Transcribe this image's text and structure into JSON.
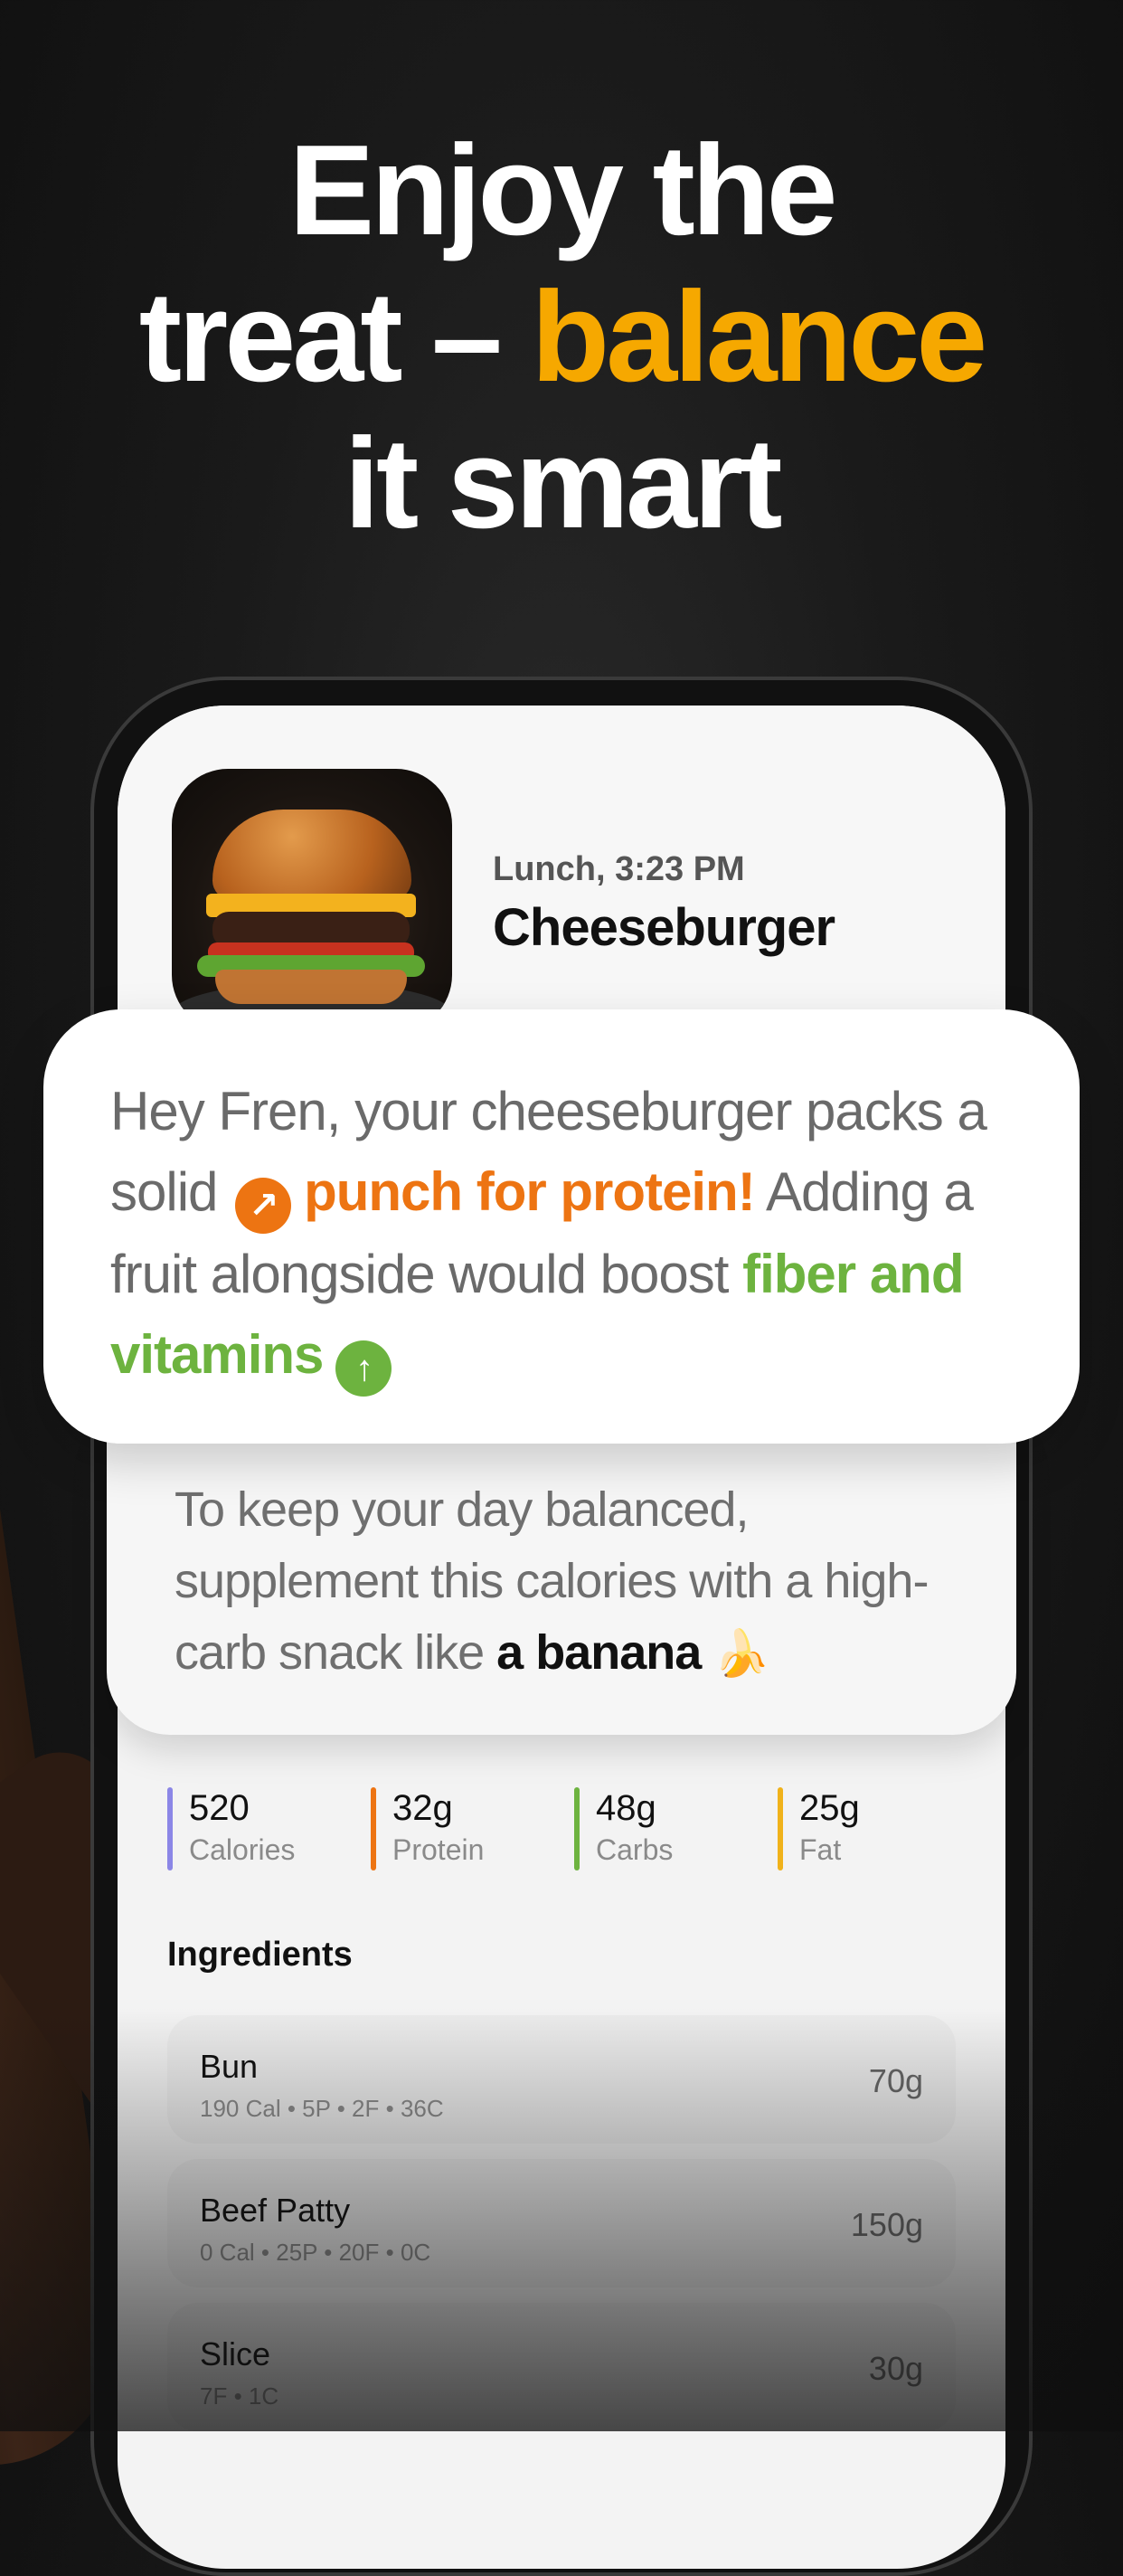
{
  "headline": {
    "line1": "Enjoy the",
    "line2_plain": "treat – ",
    "line2_accent": "balance",
    "line3": "it smart",
    "accent_color": "#f6a800"
  },
  "meal": {
    "time": "Lunch, 3:23 PM",
    "name": "Cheeseburger",
    "image_icon": "cheeseburger-photo"
  },
  "insight_card": {
    "text1": "Hey Fren, your cheeseburger packs a solid ",
    "highlight1": "punch for protein!",
    "highlight1_icon": "arrow-up-right-icon",
    "highlight1_color": "#ed7412",
    "text2": " Adding a fruit alongside would boost ",
    "highlight2": "fiber and vitamins",
    "highlight2_icon": "arrow-up-icon",
    "highlight2_color": "#6db33f"
  },
  "tip_card": {
    "text": "To keep your day balanced, supplement this calories with a high-carb snack like ",
    "bold": "a banana",
    "emoji": "🍌"
  },
  "macros": [
    {
      "value": "520",
      "label": "Calories",
      "color": "#8b86e6"
    },
    {
      "value": "32g",
      "label": "Protein",
      "color": "#ed7412"
    },
    {
      "value": "48g",
      "label": "Carbs",
      "color": "#6db33f"
    },
    {
      "value": "25g",
      "label": "Fat",
      "color": "#f0b21a"
    }
  ],
  "ingredients": {
    "title": "Ingredients",
    "items": [
      {
        "name": "Bun",
        "detail": "190 Cal • 5P • 2F • 36C",
        "weight": "70g"
      },
      {
        "name": "Beef Patty",
        "detail": "0 Cal • 25P • 20F • 0C",
        "weight": "150g"
      },
      {
        "name": "Slice",
        "detail": "7F • 1C",
        "weight": "30g"
      }
    ]
  }
}
